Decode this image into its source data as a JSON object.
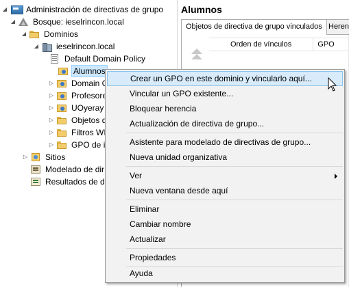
{
  "tree": {
    "root": "Administración de directivas de grupo",
    "forest": "Bosque: ieselrincon.local",
    "domains": "Dominios",
    "domain": "ieselrincon.local",
    "default_policy": "Default Domain Policy",
    "alumnos": "Alumnos",
    "domain_controllers": "Domain C",
    "profesores": "Profesore",
    "uoyeray": "UOyeray",
    "gpo_objects": "Objetos d",
    "wmi_filters": "Filtros WI",
    "starter_gpo": "GPO de in",
    "sites": "Sitios",
    "modeling": "Modelado de dir",
    "results": "Resultados de di"
  },
  "right_pane": {
    "title": "Alumnos",
    "tabs": [
      "Objetos de directiva de grupo vinculados",
      "Herencia"
    ],
    "columns": [
      "Orden de vínculos",
      "GPO"
    ]
  },
  "context_menu": {
    "items": [
      "Crear un GPO en este dominio y vincularlo aquí...",
      "Vincular un GPO existente...",
      "Bloquear herencia",
      "Actualización de directiva de grupo...",
      "Asistente para modelado de directivas de grupo...",
      "Nueva unidad organizativa",
      "Ver",
      "Nueva ventana desde aquí",
      "Eliminar",
      "Cambiar nombre",
      "Actualizar",
      "Propiedades",
      "Ayuda"
    ]
  },
  "colors": {
    "selection": "#cce8ff",
    "menu_highlight": "#d7ebfb",
    "menu_bg": "#f2f2f2"
  }
}
